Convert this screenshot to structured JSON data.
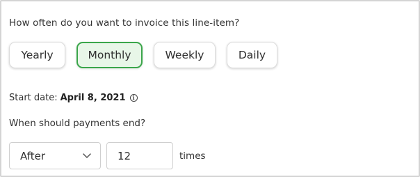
{
  "frequency": {
    "question": "How often do you want to invoice this line-item?",
    "options": [
      {
        "label": "Yearly",
        "selected": false
      },
      {
        "label": "Monthly",
        "selected": true
      },
      {
        "label": "Weekly",
        "selected": false
      },
      {
        "label": "Daily",
        "selected": false
      }
    ],
    "selected": "Monthly"
  },
  "start_date": {
    "label": "Start date:",
    "value": "April 8, 2021",
    "info_icon": "info-circle-icon"
  },
  "payments_end": {
    "question": "When should payments end?",
    "mode_select": {
      "value": "After",
      "icon": "chevron-down-icon"
    },
    "count_input": {
      "value": "12"
    },
    "unit_label": "times"
  },
  "colors": {
    "selected_border": "#3aa64a",
    "selected_background": "#e8f6e8",
    "frame_border": "#d4d4d4"
  }
}
